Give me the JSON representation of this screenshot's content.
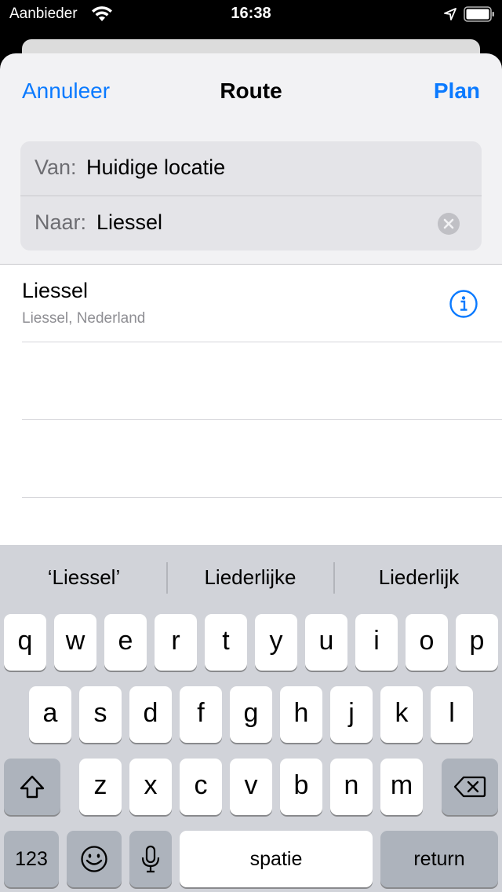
{
  "status_bar": {
    "carrier": "Aanbieder",
    "time": "16:38"
  },
  "nav": {
    "cancel_label": "Annuleer",
    "title": "Route",
    "plan_label": "Plan"
  },
  "route": {
    "from_label": "Van:",
    "from_value": "Huidige locatie",
    "to_label": "Naar:",
    "to_value": "Liessel"
  },
  "results": [
    {
      "title": "Liessel",
      "subtitle": "Liessel, Nederland"
    }
  ],
  "keyboard": {
    "suggestions": [
      "‘Liessel’",
      "Liederlijke",
      "Liederlijk"
    ],
    "row1": [
      "q",
      "w",
      "e",
      "r",
      "t",
      "y",
      "u",
      "i",
      "o",
      "p"
    ],
    "row2": [
      "a",
      "s",
      "d",
      "f",
      "g",
      "h",
      "j",
      "k",
      "l"
    ],
    "row3": [
      "z",
      "x",
      "c",
      "v",
      "b",
      "n",
      "m"
    ],
    "numbers_label": "123",
    "space_label": "spatie",
    "return_label": "return"
  },
  "colors": {
    "accent": "#0a7aff",
    "sheet_bg": "#f2f2f4",
    "keyboard_bg": "#d1d3d9"
  },
  "icons": [
    "wifi-icon",
    "location-arrow-icon",
    "battery-icon",
    "clear-icon",
    "info-icon",
    "shift-icon",
    "backspace-icon",
    "emoji-icon",
    "microphone-icon"
  ]
}
